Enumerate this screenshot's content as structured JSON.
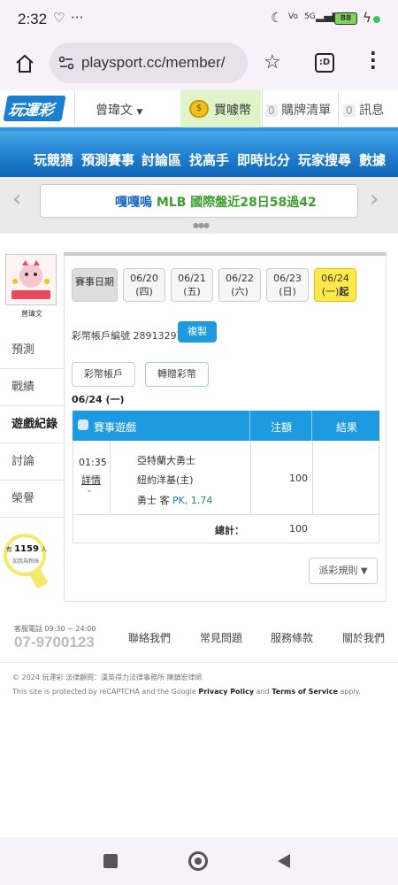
{
  "status_bar": {
    "time": "2:32",
    "battery": "88",
    "signal": "5G"
  },
  "browser": {
    "url": "playsport.cc/member/"
  },
  "site_header": {
    "logo": "玩運彩",
    "username": "曾瑋文",
    "buy_coins": "買噱幣",
    "cart_count": "0",
    "cart_label": "購牌清單",
    "msg_count": "0",
    "msg_label": "訊息"
  },
  "nav": {
    "items": [
      "玩競猜",
      "預測賽事",
      "討論區",
      "找高手",
      "即時比分",
      "玩家搜尋",
      "數據"
    ]
  },
  "marquee": {
    "highlight": "嘎嘎嗚",
    "text": "MLB 國際盤近28日58過42"
  },
  "sidebar": {
    "avatar_name": "曾瑋文",
    "items": [
      "預測",
      "戰績",
      "遊戲紀錄",
      "討論",
      "榮譽"
    ],
    "active_index": 2,
    "online_prefix": "有",
    "online_count": "1159",
    "online_suffix": "人",
    "online_sub": "加我為粉絲"
  },
  "dates": {
    "label": "賽事日期",
    "items": [
      {
        "date": "06/20",
        "dow": "(四)"
      },
      {
        "date": "06/21",
        "dow": "(五)"
      },
      {
        "date": "06/22",
        "dow": "(六)"
      },
      {
        "date": "06/23",
        "dow": "(日)"
      },
      {
        "date": "06/24",
        "dow": "(一)",
        "extra": "起"
      }
    ]
  },
  "account": {
    "label": "彩幣帳戶編號",
    "number": "28913297",
    "copy_btn": "複製"
  },
  "tabs": {
    "account": "彩幣帳戶",
    "transfer": "轉贈彩幣"
  },
  "current_date": "06/24 (一)",
  "table": {
    "headers": {
      "game": "賽事遊戲",
      "amount": "注額",
      "result": "結果"
    },
    "rows": [
      {
        "time": "01:35",
        "detail": "詳情",
        "team1": "亞特蘭大勇士",
        "team2": "紐約洋基(主)",
        "amount": "100",
        "pick_team": "勇士",
        "pick_side": "客",
        "pick_type": "PK,",
        "pick_odds": "1.74"
      }
    ],
    "total_label": "總計：",
    "total_value": "100"
  },
  "rules_btn": "派彩規則",
  "footer": {
    "service_label": "客服電話 09:30 ~ 24:00",
    "phone": "07-9700123",
    "links": [
      "聯絡我們",
      "常見問題",
      "服務條款",
      "關於我們"
    ],
    "copyright": "© 2024 玩運彩 法律顧問：漢英得力法律事務所 陳鎮宏律師",
    "recaptcha_pre": "This site is protected by reCAPTCHA and the Google",
    "privacy": "Privacy Policy",
    "and": "and",
    "terms": "Terms of Service",
    "apply": "apply."
  }
}
